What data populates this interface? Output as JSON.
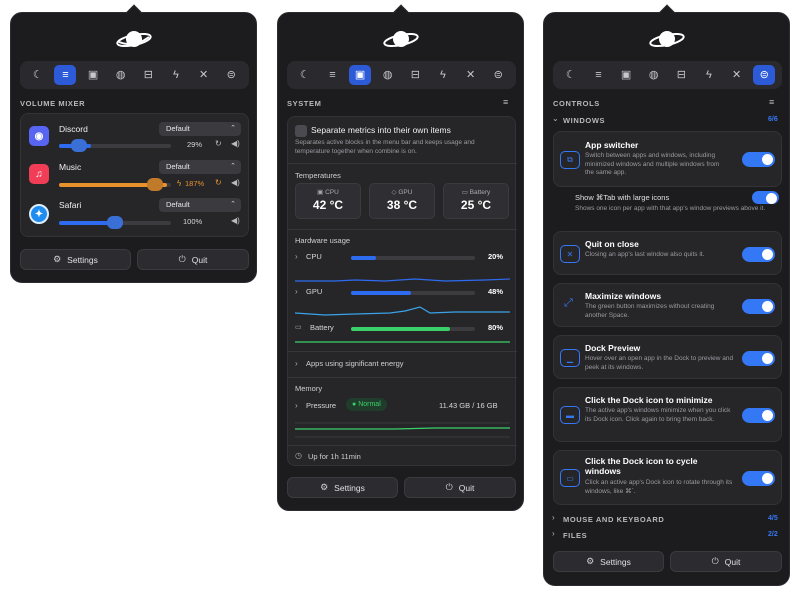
{
  "colors": {
    "accent": "#3478f6",
    "orange": "#e8922e",
    "green": "#3ad16a",
    "panel": "#1c1c1f"
  },
  "toolbar_icons": [
    "moon-stars-icon",
    "sliders-icon",
    "chip-icon",
    "globe-icon",
    "drive-icon",
    "bolt-icon",
    "tools-icon",
    "toggles-icon"
  ],
  "panel1": {
    "section": "VOLUME MIXER",
    "active_tab": 1,
    "apps": [
      {
        "name": "Discord",
        "output": "Default",
        "volume_text": "29%",
        "volume": 0.29,
        "icon": "discord-icon",
        "color": "#5865f2"
      },
      {
        "name": "Music",
        "output": "Default",
        "volume_text": "187%",
        "volume": 0.98,
        "icon": "music-icon",
        "color": "#f23d56"
      },
      {
        "name": "Safari",
        "output": "Default",
        "volume_text": "100%",
        "volume": 0.57,
        "icon": "safari-icon",
        "color": "#1f8cf0"
      }
    ],
    "settings": "Settings",
    "quit": "Quit"
  },
  "panel2": {
    "section": "SYSTEM",
    "active_tab": 2,
    "separate_title": "Separate metrics into their own items",
    "separate_desc": "Separates active blocks in the menu bar and keeps usage and temperature together when combine is on.",
    "temperatures_label": "Temperatures",
    "temps": [
      {
        "label": "CPU",
        "value": "42 °C",
        "icon": "cpu-icon"
      },
      {
        "label": "GPU",
        "value": "38 °C",
        "icon": "gpu-icon"
      },
      {
        "label": "Battery",
        "value": "25 °C",
        "icon": "battery-icon"
      }
    ],
    "hardware_label": "Hardware usage",
    "usage": [
      {
        "label": "CPU",
        "value": "20%",
        "fraction": 0.2,
        "color": "#2d6cf0"
      },
      {
        "label": "GPU",
        "value": "48%",
        "fraction": 0.48,
        "color": "#2d6cf0"
      },
      {
        "label": "Battery",
        "value": "80%",
        "fraction": 0.8,
        "color": "#3ad16a"
      }
    ],
    "energy": "Apps using significant energy",
    "memory_label": "Memory",
    "pressure_label": "Pressure",
    "pressure_badge": "Normal",
    "memory_value": "11.43 GB / 16 GB",
    "uptime": "Up for 1h 11min",
    "settings": "Settings",
    "quit": "Quit"
  },
  "panel3": {
    "section": "CONTROLS",
    "active_tab": 7,
    "windows_label": "WINDOWS",
    "windows_count": "6/6",
    "items": [
      {
        "title": "App switcher",
        "desc": "Switch between apps and windows, including minimized windows and multiple windows from the same app.",
        "icon": "windows-icon"
      },
      {
        "title": "Quit on close",
        "desc": "Closing an app's last window also quits it.",
        "icon": "close-window-icon"
      },
      {
        "title": "Maximize windows",
        "desc": "The green button maximizes without creating another Space.",
        "icon": "maximize-icon"
      },
      {
        "title": "Dock Preview",
        "desc": "Hover over an open app in the Dock to preview and peek at its windows.",
        "icon": "dock-icon"
      },
      {
        "title": "Click the Dock icon to minimize",
        "desc": "The active app's windows minimize when you click its Dock icon. Click again to bring them back.",
        "icon": "minimize-icon"
      },
      {
        "title": "Click the Dock icon to cycle windows",
        "desc": "Click an active app's Dock icon to rotate through its windows, like ⌘`.",
        "icon": "cycle-icon"
      }
    ],
    "show_tab_title": "Show ⌘Tab with large icons",
    "show_tab_desc": "Shows one icon per app with that app's window previews above it.",
    "mouse_label": "MOUSE AND KEYBOARD",
    "mouse_count": "4/5",
    "files_label": "FILES",
    "files_count": "2/2",
    "settings": "Settings",
    "quit": "Quit"
  }
}
